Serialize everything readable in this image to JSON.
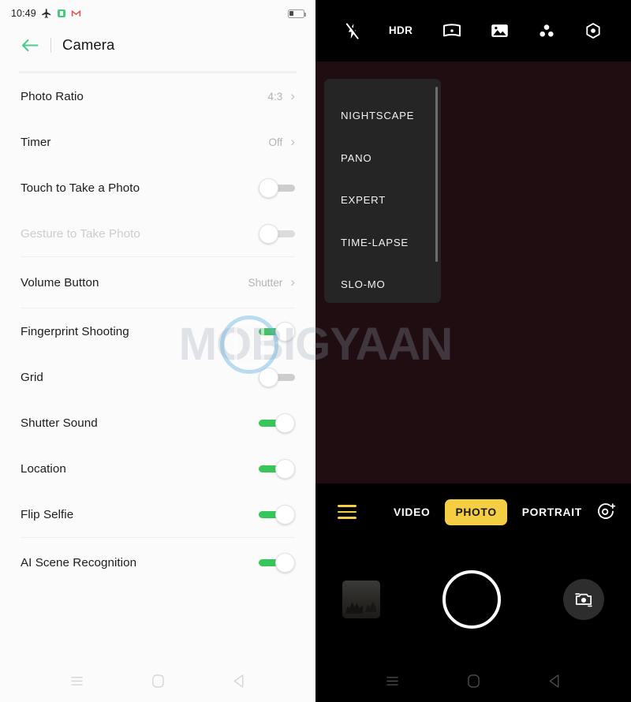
{
  "status_bar": {
    "time": "10:49",
    "icons": [
      "airplane-mode-icon",
      "app-notification-icon",
      "gmail-icon"
    ],
    "battery_level_pct": 26
  },
  "settings": {
    "header": {
      "back_icon": "back-arrow-icon",
      "title": "Camera"
    },
    "groups": [
      {
        "rows": [
          {
            "label": "Photo Ratio",
            "type": "value",
            "value": "4:3",
            "chevron": "›"
          },
          {
            "label": "Timer",
            "type": "value",
            "value": "Off",
            "chevron": "›"
          },
          {
            "label": "Touch to Take a Photo",
            "type": "toggle",
            "state": "off",
            "disabled": false
          },
          {
            "label": "Gesture to Take Photo",
            "type": "toggle",
            "state": "off",
            "disabled": true
          }
        ]
      },
      {
        "rows": [
          {
            "label": "Volume Button",
            "type": "value",
            "value": "Shutter",
            "chevron": "›"
          }
        ]
      },
      {
        "rows": [
          {
            "label": "Fingerprint Shooting",
            "type": "toggle",
            "state": "on",
            "disabled": false
          },
          {
            "label": "Grid",
            "type": "toggle",
            "state": "off",
            "disabled": false
          },
          {
            "label": "Shutter Sound",
            "type": "toggle",
            "state": "on",
            "disabled": false
          },
          {
            "label": "Location",
            "type": "toggle",
            "state": "on",
            "disabled": false
          },
          {
            "label": "Flip Selfie",
            "type": "toggle",
            "state": "on",
            "disabled": false
          }
        ]
      },
      {
        "rows": [
          {
            "label": "AI Scene Recognition",
            "type": "toggle",
            "state": "on",
            "disabled": false
          }
        ]
      }
    ]
  },
  "camera": {
    "topbar": [
      {
        "name": "flash-off-icon",
        "label": ""
      },
      {
        "name": "hdr-icon",
        "label": "HDR"
      },
      {
        "name": "wide-angle-icon",
        "label": ""
      },
      {
        "name": "gallery-icon",
        "label": ""
      },
      {
        "name": "filters-icon",
        "label": ""
      },
      {
        "name": "camera-settings-icon",
        "label": ""
      }
    ],
    "mode_dropdown": {
      "items": [
        "NIGHTSCAPE",
        "PANO",
        "EXPERT",
        "TIME-LAPSE",
        "SLO-MO"
      ],
      "scrollbar_visible": true
    },
    "mode_bar": {
      "menu_icon": "hamburger-menu-icon",
      "tabs": [
        {
          "label": "VIDEO",
          "active": false
        },
        {
          "label": "PHOTO",
          "active": true
        },
        {
          "label": "PORTRAIT",
          "active": false
        }
      ],
      "beauty_icon": "beauty-mode-icon",
      "active_color": "#f5ce43"
    },
    "controls": {
      "gallery_thumb": "gallery-thumbnail",
      "shutter": "shutter-button",
      "switch_camera": "switch-camera-button"
    }
  },
  "nav_bar": {
    "recents_label": "recents-icon",
    "home_label": "home-icon",
    "back_label": "back-icon"
  },
  "watermark": {
    "text": "MOBIGYAAN"
  },
  "colors": {
    "accent_green": "#35c759",
    "accent_yellow": "#f5ce43",
    "back_arrow_green": "#4cc98c",
    "preview_bg": "#1f0d12"
  }
}
